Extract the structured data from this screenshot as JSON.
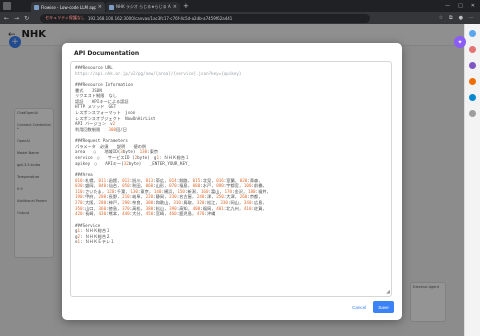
{
  "browser": {
    "tabs": [
      {
        "title": "Flowise - Low-code LLM apps b..."
      },
      {
        "title": "NHK ラジオ らじる★らじる API (ver..."
      }
    ],
    "url_warning": "セキュリティ保護なし",
    "url": "192.168.100.162:3000/canvas/1ac3fc17-c76f-4c5d-a2db-a7459f62a441"
  },
  "app": {
    "title": "NHK",
    "node_labels": [
      "ChatOpenAI",
      "Connect Credential *",
      "OpenAI",
      "Model Name",
      "gpt-3.5-turbo",
      "Temperature",
      "0.9",
      "Additional Param",
      "Output"
    ],
    "node2_label": "External Agent"
  },
  "modal": {
    "title": "API Documentation",
    "lines": [
      "###Resource URL",
      "https://api.nhk.or.jp/v2/pg/now/{area}/{service}.json?key={apikey}",
      "",
      "###Resource Information",
      "書式　　JSON",
      "リクエスト制限　なし",
      "認証　　APIキーによる認証",
      "HTTP メソッド　GET",
      "レスポンスフォーマット　json",
      "レスポンスオブジェクト　NowOnAirList",
      "API バージョン　v2",
      "利用回数制限　　300回/日",
      "",
      "###Request Parameters",
      "パラメータ　必須　　説明　　値の例",
      "area　　○　　地域ID(3byte)　130:東京",
      "service　○　　サービスID (2byte)　g1: ＮＨＫ総合１",
      "apikey　○　　APIキー(32byte)　　_ENTER_YOUR_KEY_",
      "",
      "###Area",
      "010:札幌, 011:函館, 012:旭川, 013:帯広, 014:釧路, 015:北見, 016:室蘭, 020:青森,",
      "030:盛岡, 040:仙台, 050:秋田, 060:山形, 070:福島, 080:水戸, 090:宇都宮, 100:前橋,",
      "110:さいたま, 120:千葉, 130:東京, 140:横浜, 150:新潟, 160:富山, 170:金沢, 180:福井,",
      "190:甲府, 200:長野, 210:岐阜, 220:静岡, 230:名古屋, 240:津, 250:大津, 260:京都,",
      "270:大阪, 280:神戸, 290:奈良, 300:和歌山, 310:鳥取, 320:松江, 330:岡山, 340:広島,",
      "350:山口, 360:徳島, 370:高松, 380:松山, 390:高知, 400:福岡, 401:北九州, 410:佐賀,",
      "420:長崎, 430:熊本, 440:大分, 450:宮崎, 460:鹿児島, 470:沖縄",
      "",
      "###Service",
      "g1: ＮＨＫ総合１",
      "g2: ＮＨＫ総合２",
      "e1: ＮＨＫＥテレ１"
    ],
    "cancel_label": "Cancel",
    "save_label": "Save"
  },
  "colors": {
    "accent": "#3b82f6",
    "number": "#e06a2f"
  }
}
